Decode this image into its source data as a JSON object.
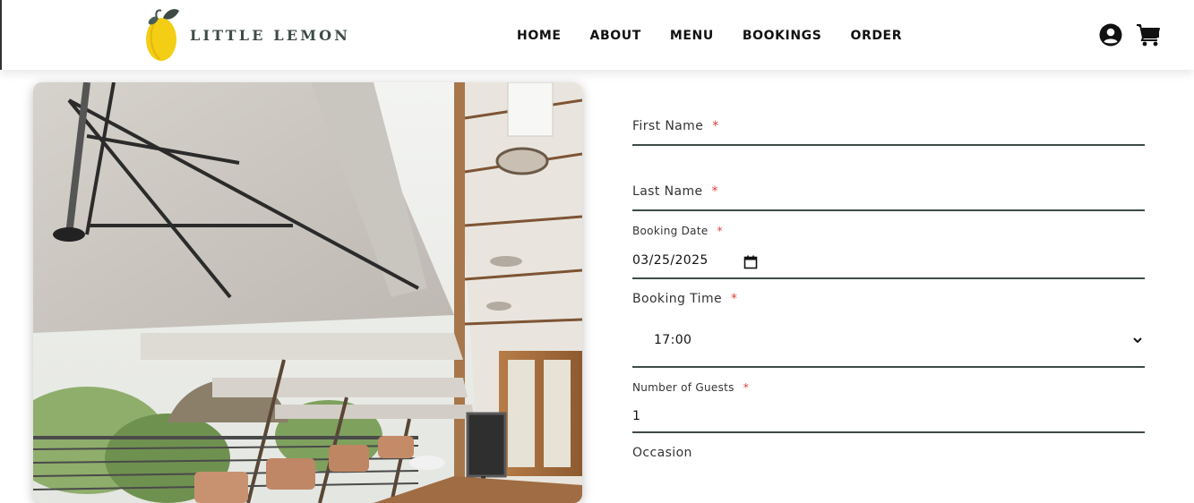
{
  "brand": {
    "name": "LITTLE LEMON",
    "logo_icon": "lemon-icon",
    "colors": {
      "primary": "#3e4b45",
      "lemon": "#f4ce14",
      "required": "#e0403a"
    }
  },
  "nav": {
    "items": [
      "HOME",
      "ABOUT",
      "MENU",
      "BOOKINGS",
      "ORDER"
    ]
  },
  "header_icons": {
    "account": "account-icon",
    "cart": "cart-icon"
  },
  "photo": {
    "subject": "restaurant-terrace-photo"
  },
  "form": {
    "first_name": {
      "label": "First Name",
      "required_mark": "*",
      "value": ""
    },
    "last_name": {
      "label": "Last Name",
      "required_mark": "*",
      "value": ""
    },
    "booking_date": {
      "label": "Booking Date",
      "required_mark": "*",
      "value": "03/25/2025",
      "icon": "calendar-icon"
    },
    "booking_time": {
      "label": "Booking Time",
      "required_mark": "*",
      "value": "17:00",
      "icon": "chevron-down-icon"
    },
    "guests": {
      "label": "Number of Guests",
      "required_mark": "*",
      "value": "1"
    },
    "occasion": {
      "label": "Occasion"
    }
  }
}
